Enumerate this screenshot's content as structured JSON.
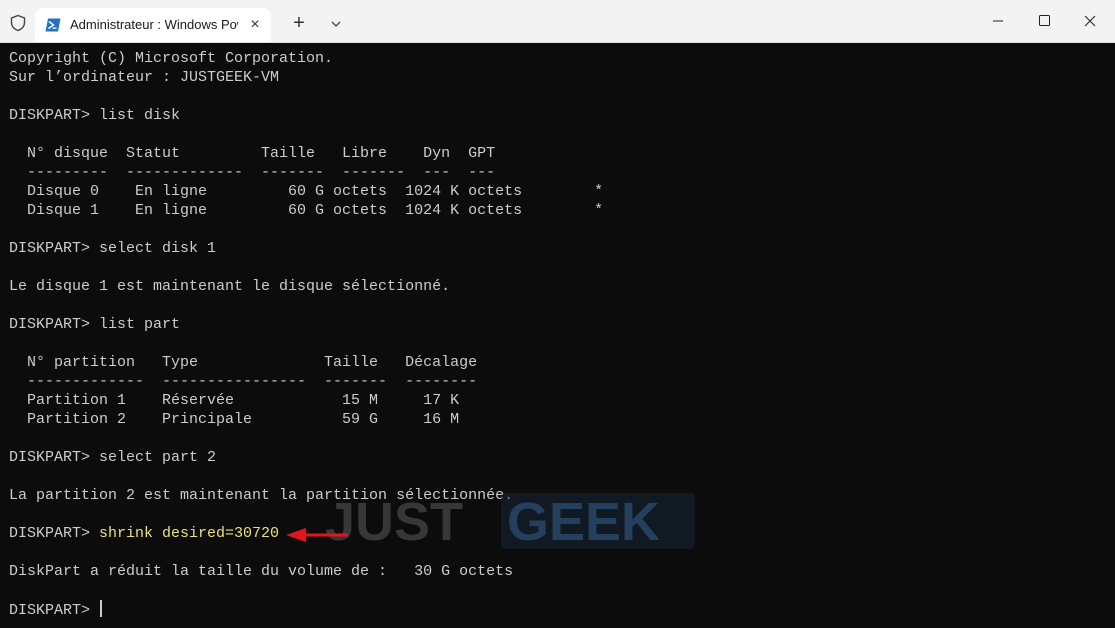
{
  "window": {
    "tab_title": "Administrateur : Windows PowerShell",
    "new_tab_icon": "plus-icon",
    "dropdown_icon": "chevron-down-icon"
  },
  "watermark": {
    "text_left": "JUST",
    "text_right": "GEEK"
  },
  "terminal": {
    "lines": [
      "Copyright (C) Microsoft Corporation.",
      "Sur l’ordinateur : JUSTGEEK-VM",
      "",
      "DISKPART> list disk",
      "",
      "  N° disque  Statut         Taille   Libre    Dyn  GPT",
      "  ---------  -------------  -------  -------  ---  ---",
      "  Disque 0    En ligne         60 G octets  1024 K octets        *",
      "  Disque 1    En ligne         60 G octets  1024 K octets        *",
      "",
      "DISKPART> select disk 1",
      "",
      "Le disque 1 est maintenant le disque sélectionné.",
      "",
      "DISKPART> list part",
      "",
      "  N° partition   Type              Taille   Décalage",
      "  -------------  ----------------  -------  --------",
      "  Partition 1    Réservée            15 M     17 K",
      "  Partition 2    Principale          59 G     16 M",
      "",
      "DISKPART> select part 2",
      "",
      "La partition 2 est maintenant la partition sélectionnée.",
      ""
    ],
    "shrink_prompt": "DISKPART> ",
    "shrink_command": "shrink desired=30720",
    "after_lines": [
      "",
      "DiskPart a réduit la taille du volume de :   30 G octets",
      ""
    ],
    "final_prompt": "DISKPART> "
  },
  "colors": {
    "background": "#0c0c0c",
    "text": "#cccccc",
    "command_highlight": "#e8e07a",
    "arrow": "#e3141b"
  }
}
